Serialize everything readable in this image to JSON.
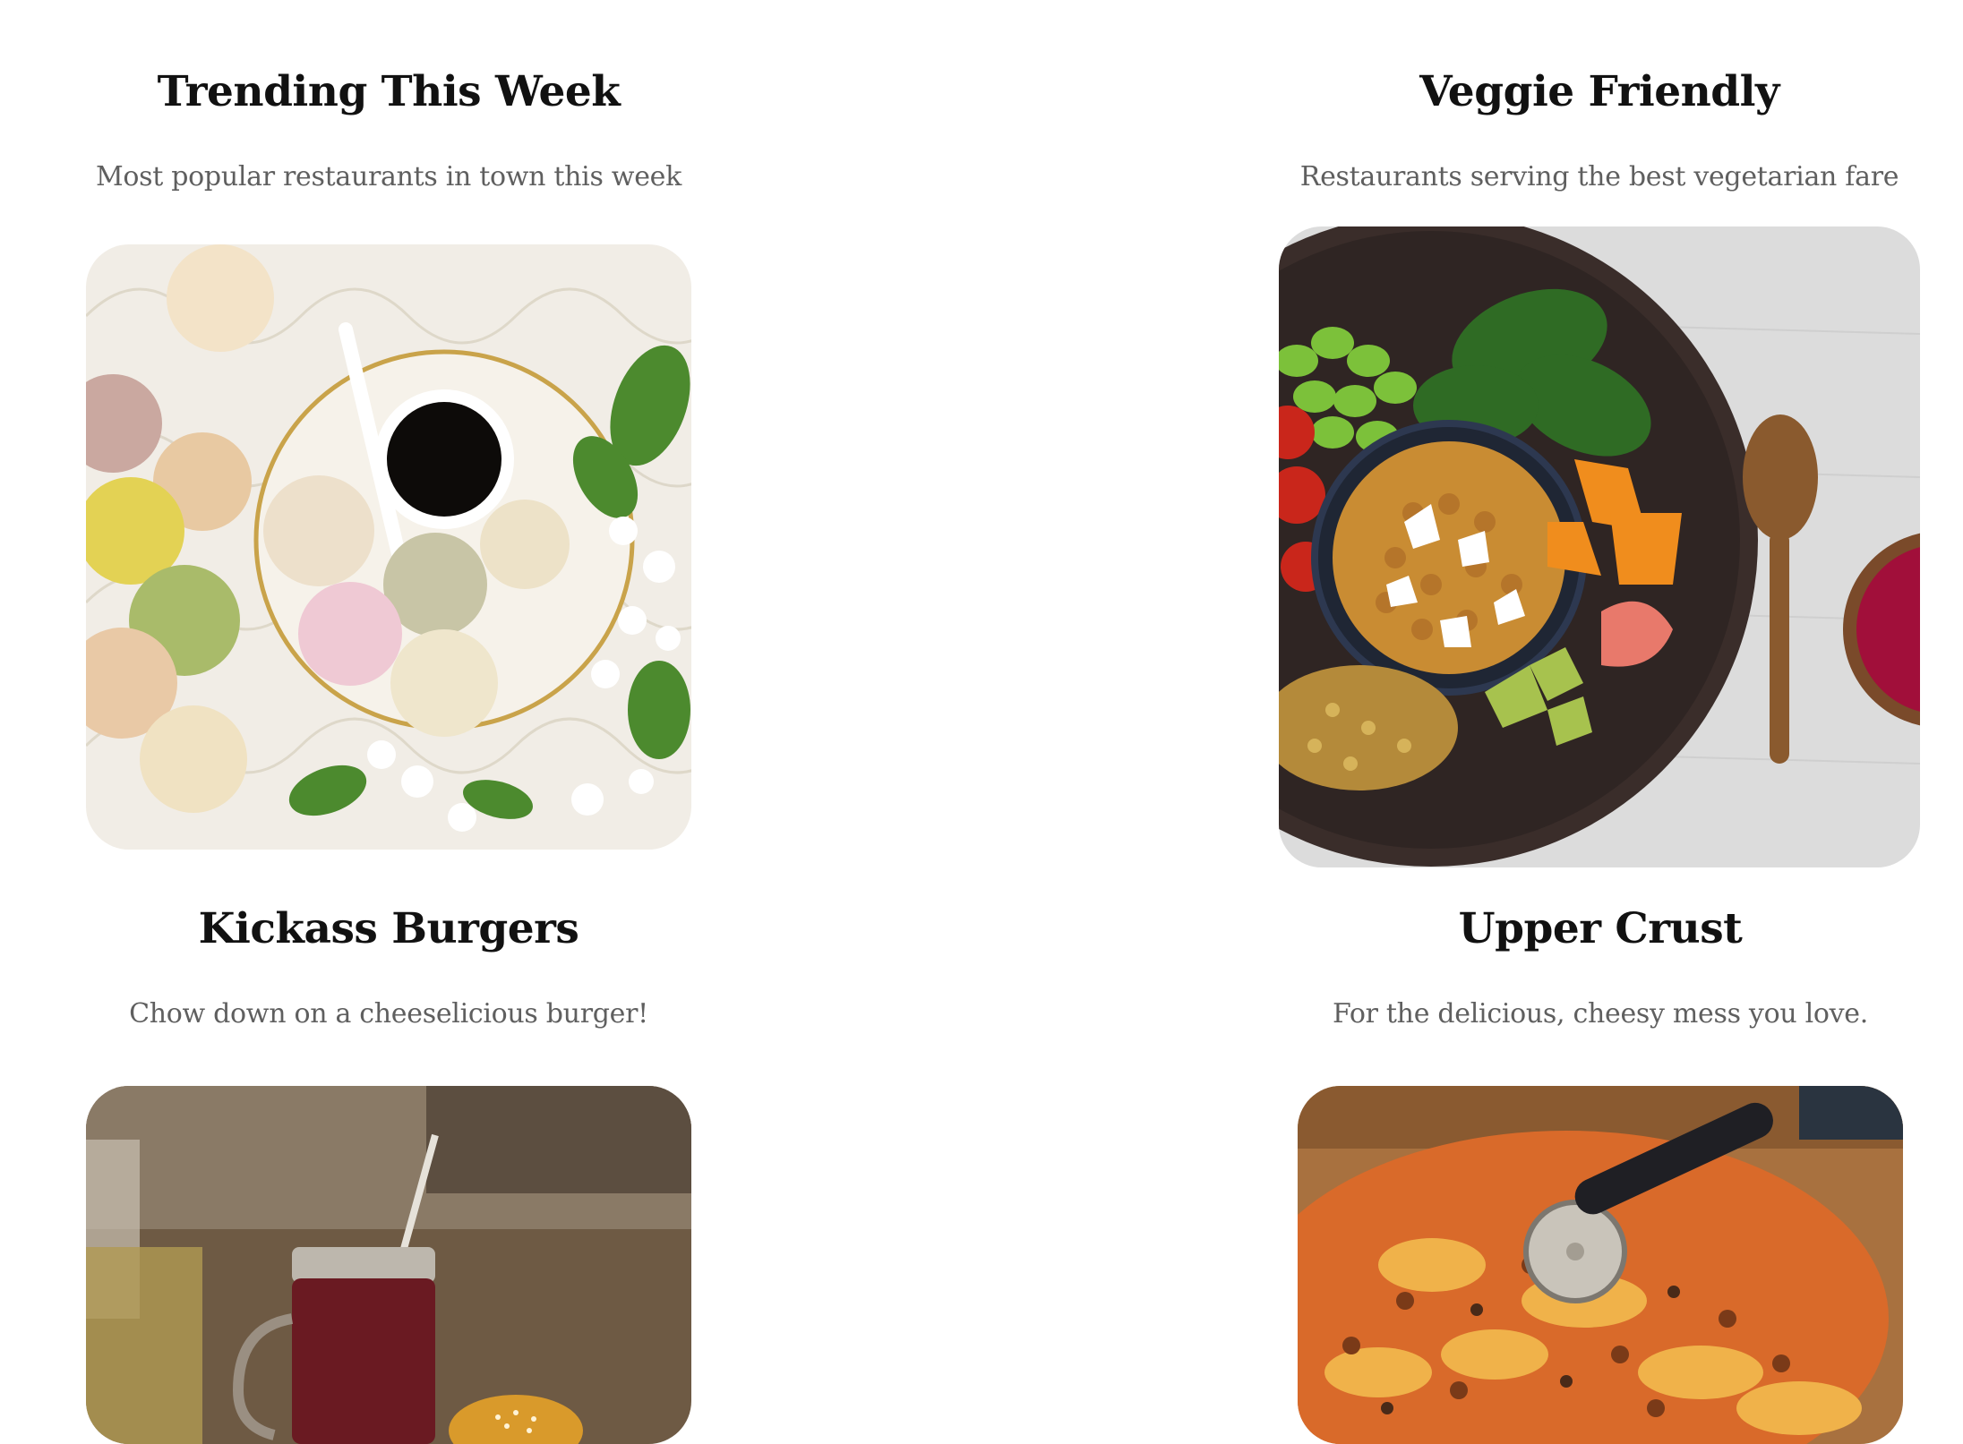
{
  "collections": [
    {
      "title": "Trending This Week",
      "subtitle": "Most popular restaurants in town this week",
      "image_icon": "macarons-coffee-photo"
    },
    {
      "title": "Veggie Friendly",
      "subtitle": "Restaurants serving the best vegetarian fare",
      "image_icon": "veggie-bowl-photo"
    },
    {
      "title": "Kickass Burgers",
      "subtitle": "Chow down on a cheeselicious burger!",
      "image_icon": "burger-drink-photo"
    },
    {
      "title": "Upper Crust",
      "subtitle": "For the delicious, cheesy mess you love.",
      "image_icon": "pizza-photo"
    }
  ]
}
